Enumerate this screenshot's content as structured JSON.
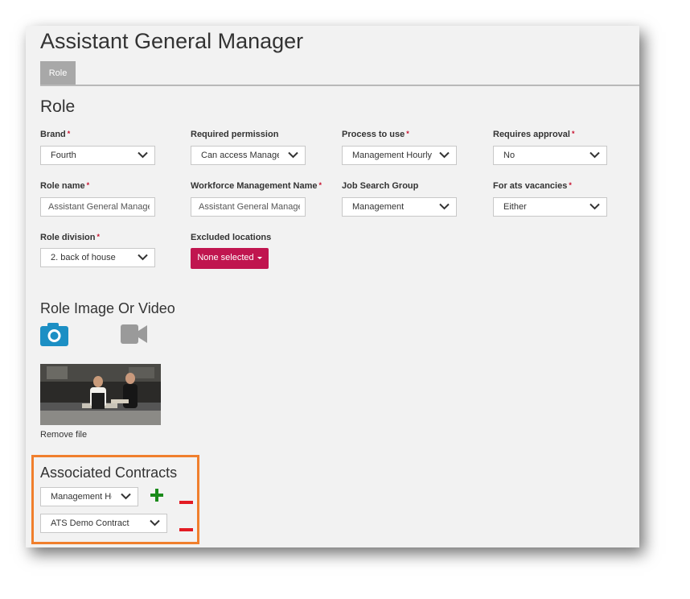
{
  "page": {
    "title": "Assistant General Manager"
  },
  "tabs": [
    {
      "label": "Role"
    }
  ],
  "role_section": {
    "title": "Role",
    "fields": {
      "brand": {
        "label": "Brand",
        "required": "*",
        "value": "Fourth"
      },
      "required_permission": {
        "label": "Required permission",
        "value": "Can access Manage"
      },
      "process_to_use": {
        "label": "Process to use",
        "required": "*",
        "value": "Management Hourly"
      },
      "requires_approval": {
        "label": "Requires approval",
        "required": "*",
        "value": "No"
      },
      "role_name": {
        "label": "Role name",
        "required": "*",
        "value": "Assistant General Manage"
      },
      "workforce_management_name": {
        "label": "Workforce Management Name",
        "required": "*",
        "value": "Assistant General Manage"
      },
      "job_search_group": {
        "label": "Job Search Group",
        "value": "Management"
      },
      "for_ats_vacancies": {
        "label": "For ats vacancies",
        "required": "*",
        "value": "Either"
      },
      "role_division": {
        "label": "Role division",
        "required": "*",
        "value": "2. back of house"
      },
      "excluded_locations": {
        "label": "Excluded locations",
        "value": "None selected"
      }
    }
  },
  "media_section": {
    "title": "Role Image Or Video",
    "icons": [
      "camera-icon",
      "video-camera-icon"
    ],
    "remove_file_label": "Remove file"
  },
  "contracts_section": {
    "title": "Associated Contracts",
    "contracts": [
      {
        "value": "Management Hc"
      },
      {
        "value": "ATS Demo Contract"
      }
    ]
  },
  "colors": {
    "accent_blue": "#1c8fc4",
    "excluded_button": "#c0154f",
    "add_green": "#1a8a1a",
    "remove_red": "#e31b23",
    "highlight_orange": "#f07f2d",
    "required_red": "#c8102e"
  }
}
